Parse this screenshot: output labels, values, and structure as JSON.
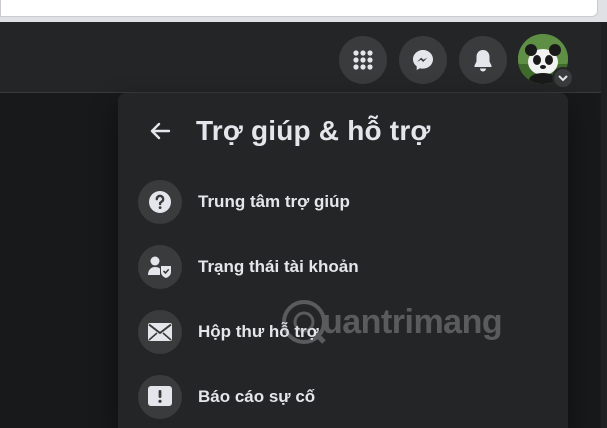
{
  "topbar": {
    "buttons": [
      {
        "name": "menu-grid",
        "icon": "grid-icon"
      },
      {
        "name": "messenger",
        "icon": "messenger-icon"
      },
      {
        "name": "notifications",
        "icon": "bell-icon"
      }
    ],
    "avatar": {
      "icon": "panda-avatar",
      "chevron": "chevron-down-icon"
    }
  },
  "menu": {
    "title": "Trợ giúp & hỗ trợ",
    "back_icon": "arrow-left-icon",
    "items": [
      {
        "label": "Trung tâm trợ giúp",
        "icon": "question-circle-icon"
      },
      {
        "label": "Trạng thái tài khoản",
        "icon": "account-status-icon"
      },
      {
        "label": "Hộp thư hỗ trợ",
        "icon": "envelope-icon"
      },
      {
        "label": "Báo cáo sự cố",
        "icon": "exclamation-icon"
      }
    ]
  },
  "watermark": {
    "text": "uantrimang"
  },
  "colors": {
    "panel": "#242526",
    "icon_bg": "#3a3b3c",
    "text": "#e4e6eb",
    "page_bg": "#18191a"
  }
}
